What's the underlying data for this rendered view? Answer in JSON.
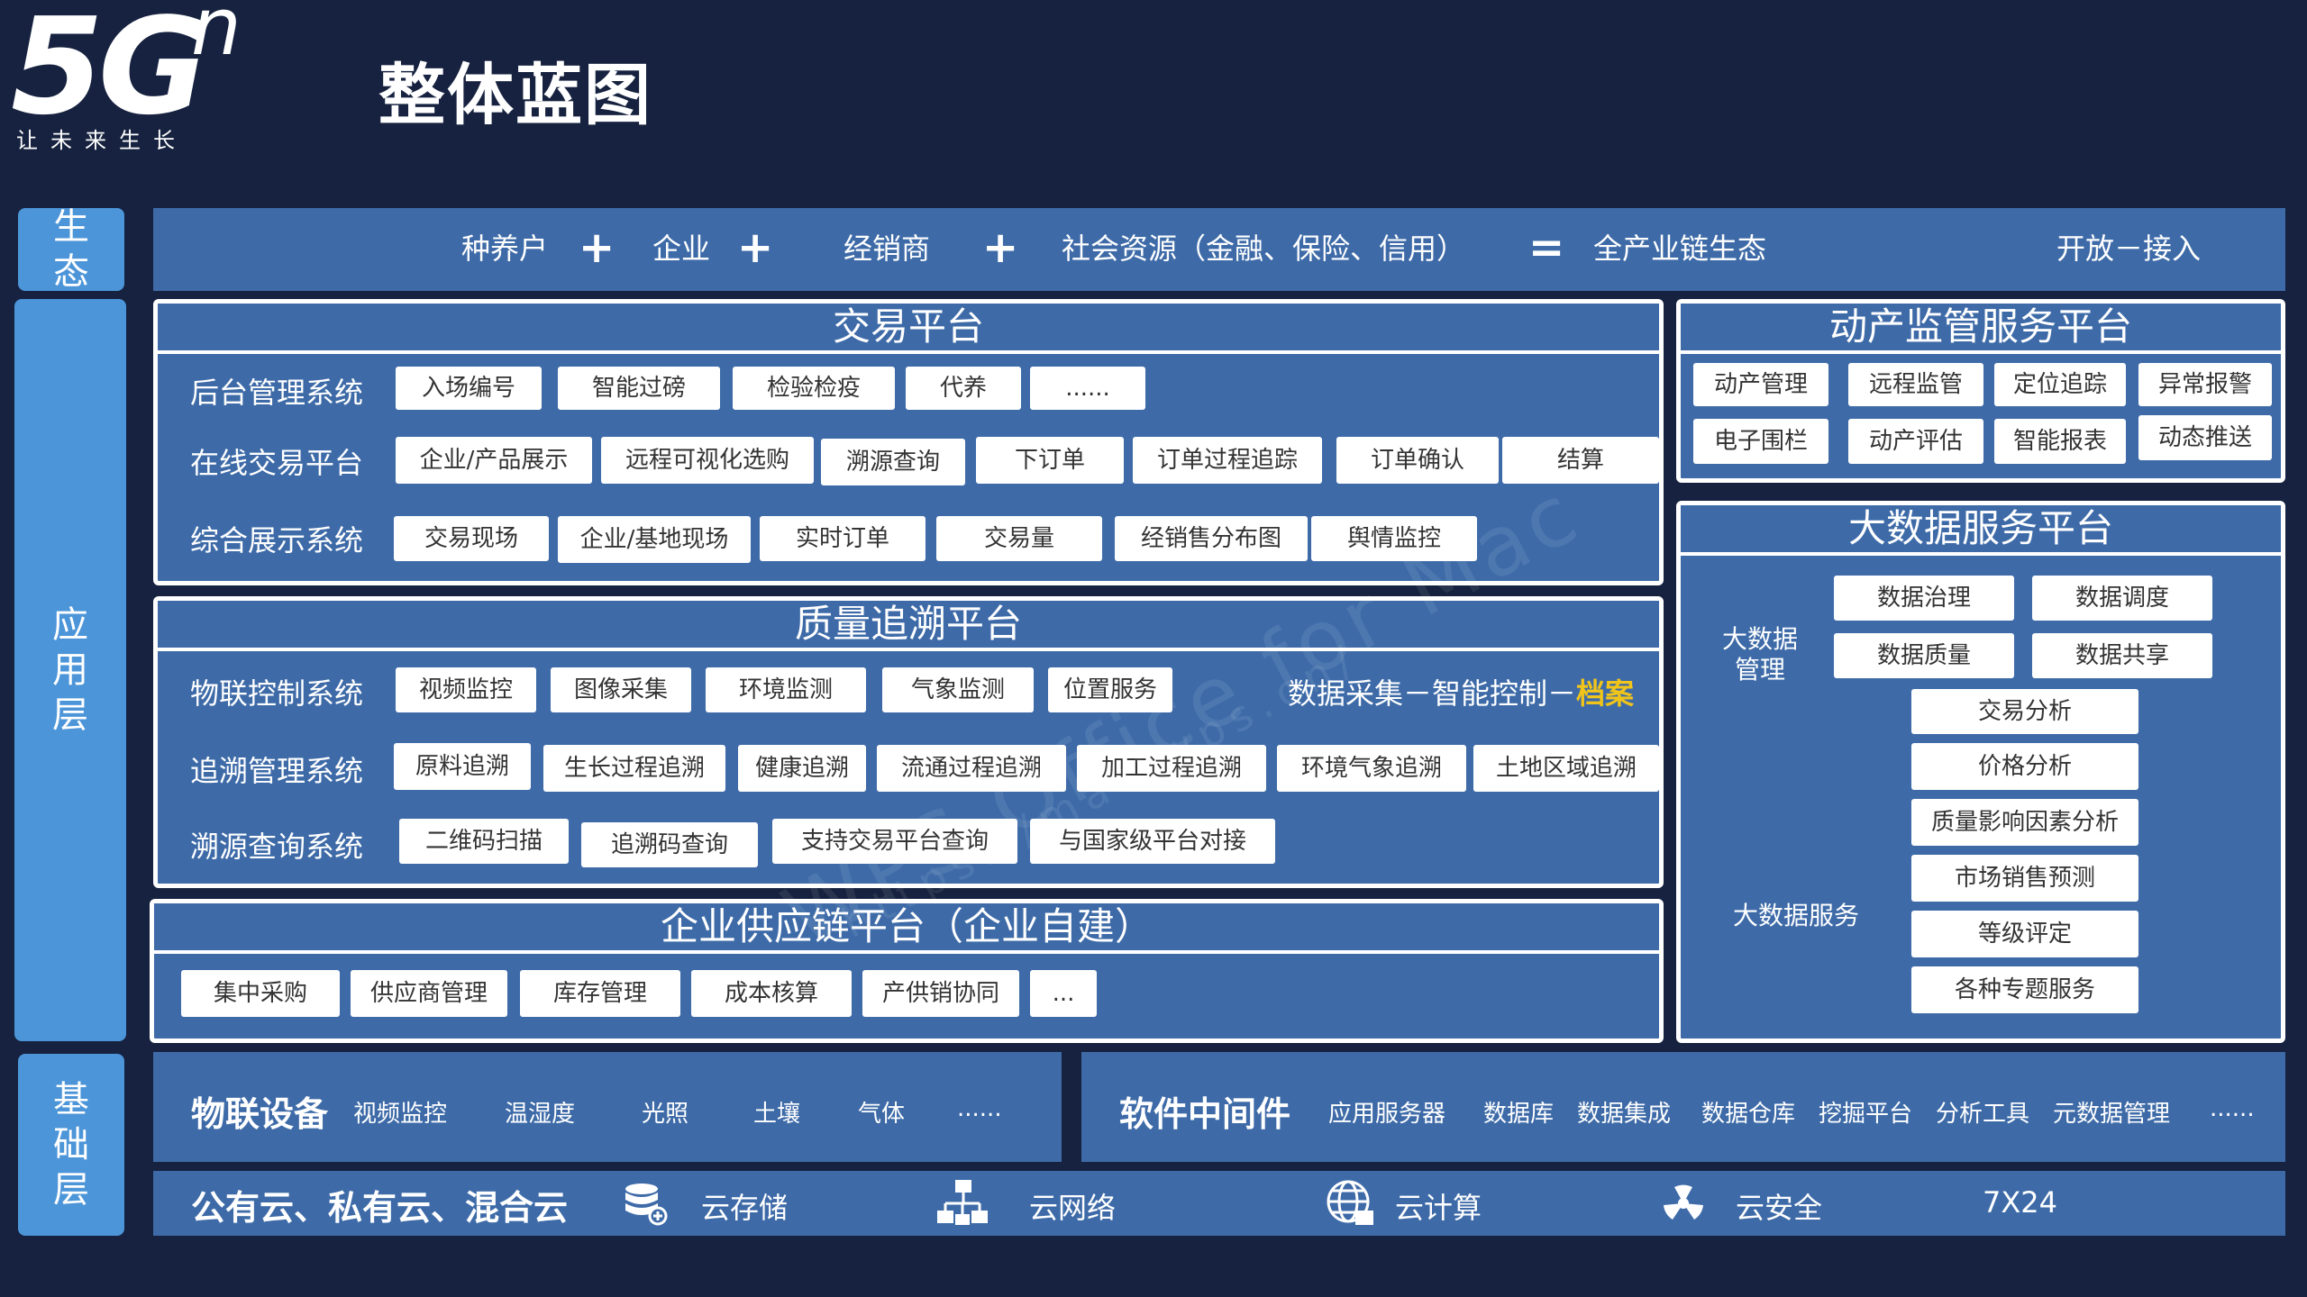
{
  "logo": {
    "main": "5G",
    "sup": "n",
    "tagline": "让未来生长"
  },
  "title": "整体蓝图",
  "layers": {
    "eco": "生态",
    "app": "应用层",
    "base": "基础层"
  },
  "eco": {
    "items": [
      "种养户",
      "企业",
      "经销商",
      "社会资源（金融、保险、信用）",
      "全产业链生态",
      "开放－接入"
    ],
    "plus": "+",
    "equals": "="
  },
  "trading": {
    "title": "交易平台",
    "rows": [
      {
        "label": "后台管理系统",
        "chips": [
          "入场编号",
          "智能过磅",
          "检验检疫",
          "代养",
          "......"
        ]
      },
      {
        "label": "在线交易平台",
        "chips": [
          "企业/产品展示",
          "远程可视化选购",
          "溯源查询",
          "下订单",
          "订单过程追踪",
          "订单确认",
          "结算"
        ]
      },
      {
        "label": "综合展示系统",
        "chips": [
          "交易现场",
          "企业/基地现场",
          "实时订单",
          "交易量",
          "经销售分布图",
          "舆情监控"
        ]
      }
    ]
  },
  "quality": {
    "title": "质量追溯平台",
    "rows": [
      {
        "label": "物联控制系统",
        "chips": [
          "视频监控",
          "图像采集",
          "环境监测",
          "气象监测",
          "位置服务"
        ]
      },
      {
        "label": "追溯管理系统",
        "chips": [
          "原料追溯",
          "生长过程追溯",
          "健康追溯",
          "流通过程追溯",
          "加工过程追溯",
          "环境气象追溯",
          "土地区域追溯"
        ]
      },
      {
        "label": "溯源查询系统",
        "chips": [
          "二维码扫描",
          "追溯码查询",
          "支持交易平台查询",
          "与国家级平台对接"
        ]
      }
    ],
    "note_prefix": "数据采集－智能控制－",
    "note_highlight": "档案"
  },
  "supply": {
    "title": "企业供应链平台（企业自建）",
    "chips": [
      "集中采购",
      "供应商管理",
      "库存管理",
      "成本核算",
      "产供销协同",
      "..."
    ]
  },
  "livestock": {
    "title": "动产监管服务平台",
    "chips": [
      "动产管理",
      "远程监管",
      "定位追踪",
      "异常报警",
      "电子围栏",
      "动产评估",
      "智能报表",
      "动态推送"
    ]
  },
  "bigdata": {
    "title": "大数据服务平台",
    "mgmt_label": "大数据管理",
    "mgmt_chips": [
      "数据治理",
      "数据调度",
      "数据质量",
      "数据共享"
    ],
    "service_label": "大数据服务",
    "service_chips": [
      "交易分析",
      "价格分析",
      "质量影响因素分析",
      "市场销售预测",
      "等级评定",
      "各种专题服务"
    ]
  },
  "iot": {
    "title": "物联设备",
    "items": [
      "视频监控",
      "温湿度",
      "光照",
      "土壤",
      "气体",
      "......"
    ]
  },
  "middleware": {
    "title": "软件中间件",
    "items": [
      "应用服务器",
      "数据库",
      "数据集成",
      "数据仓库",
      "挖掘平台",
      "分析工具",
      "元数据管理",
      "......"
    ]
  },
  "cloud": {
    "title": "公有云、私有云、混合云",
    "items": [
      {
        "icon": "database-icon",
        "label": "云存储"
      },
      {
        "icon": "network-icon",
        "label": "云网络"
      },
      {
        "icon": "globe-icon",
        "label": "云计算"
      },
      {
        "icon": "radiation-icon",
        "label": "云安全"
      }
    ],
    "extra": "7X24"
  },
  "watermark": {
    "main": "WPS Office for Mac",
    "url": "https://mac.wps.cn/"
  }
}
